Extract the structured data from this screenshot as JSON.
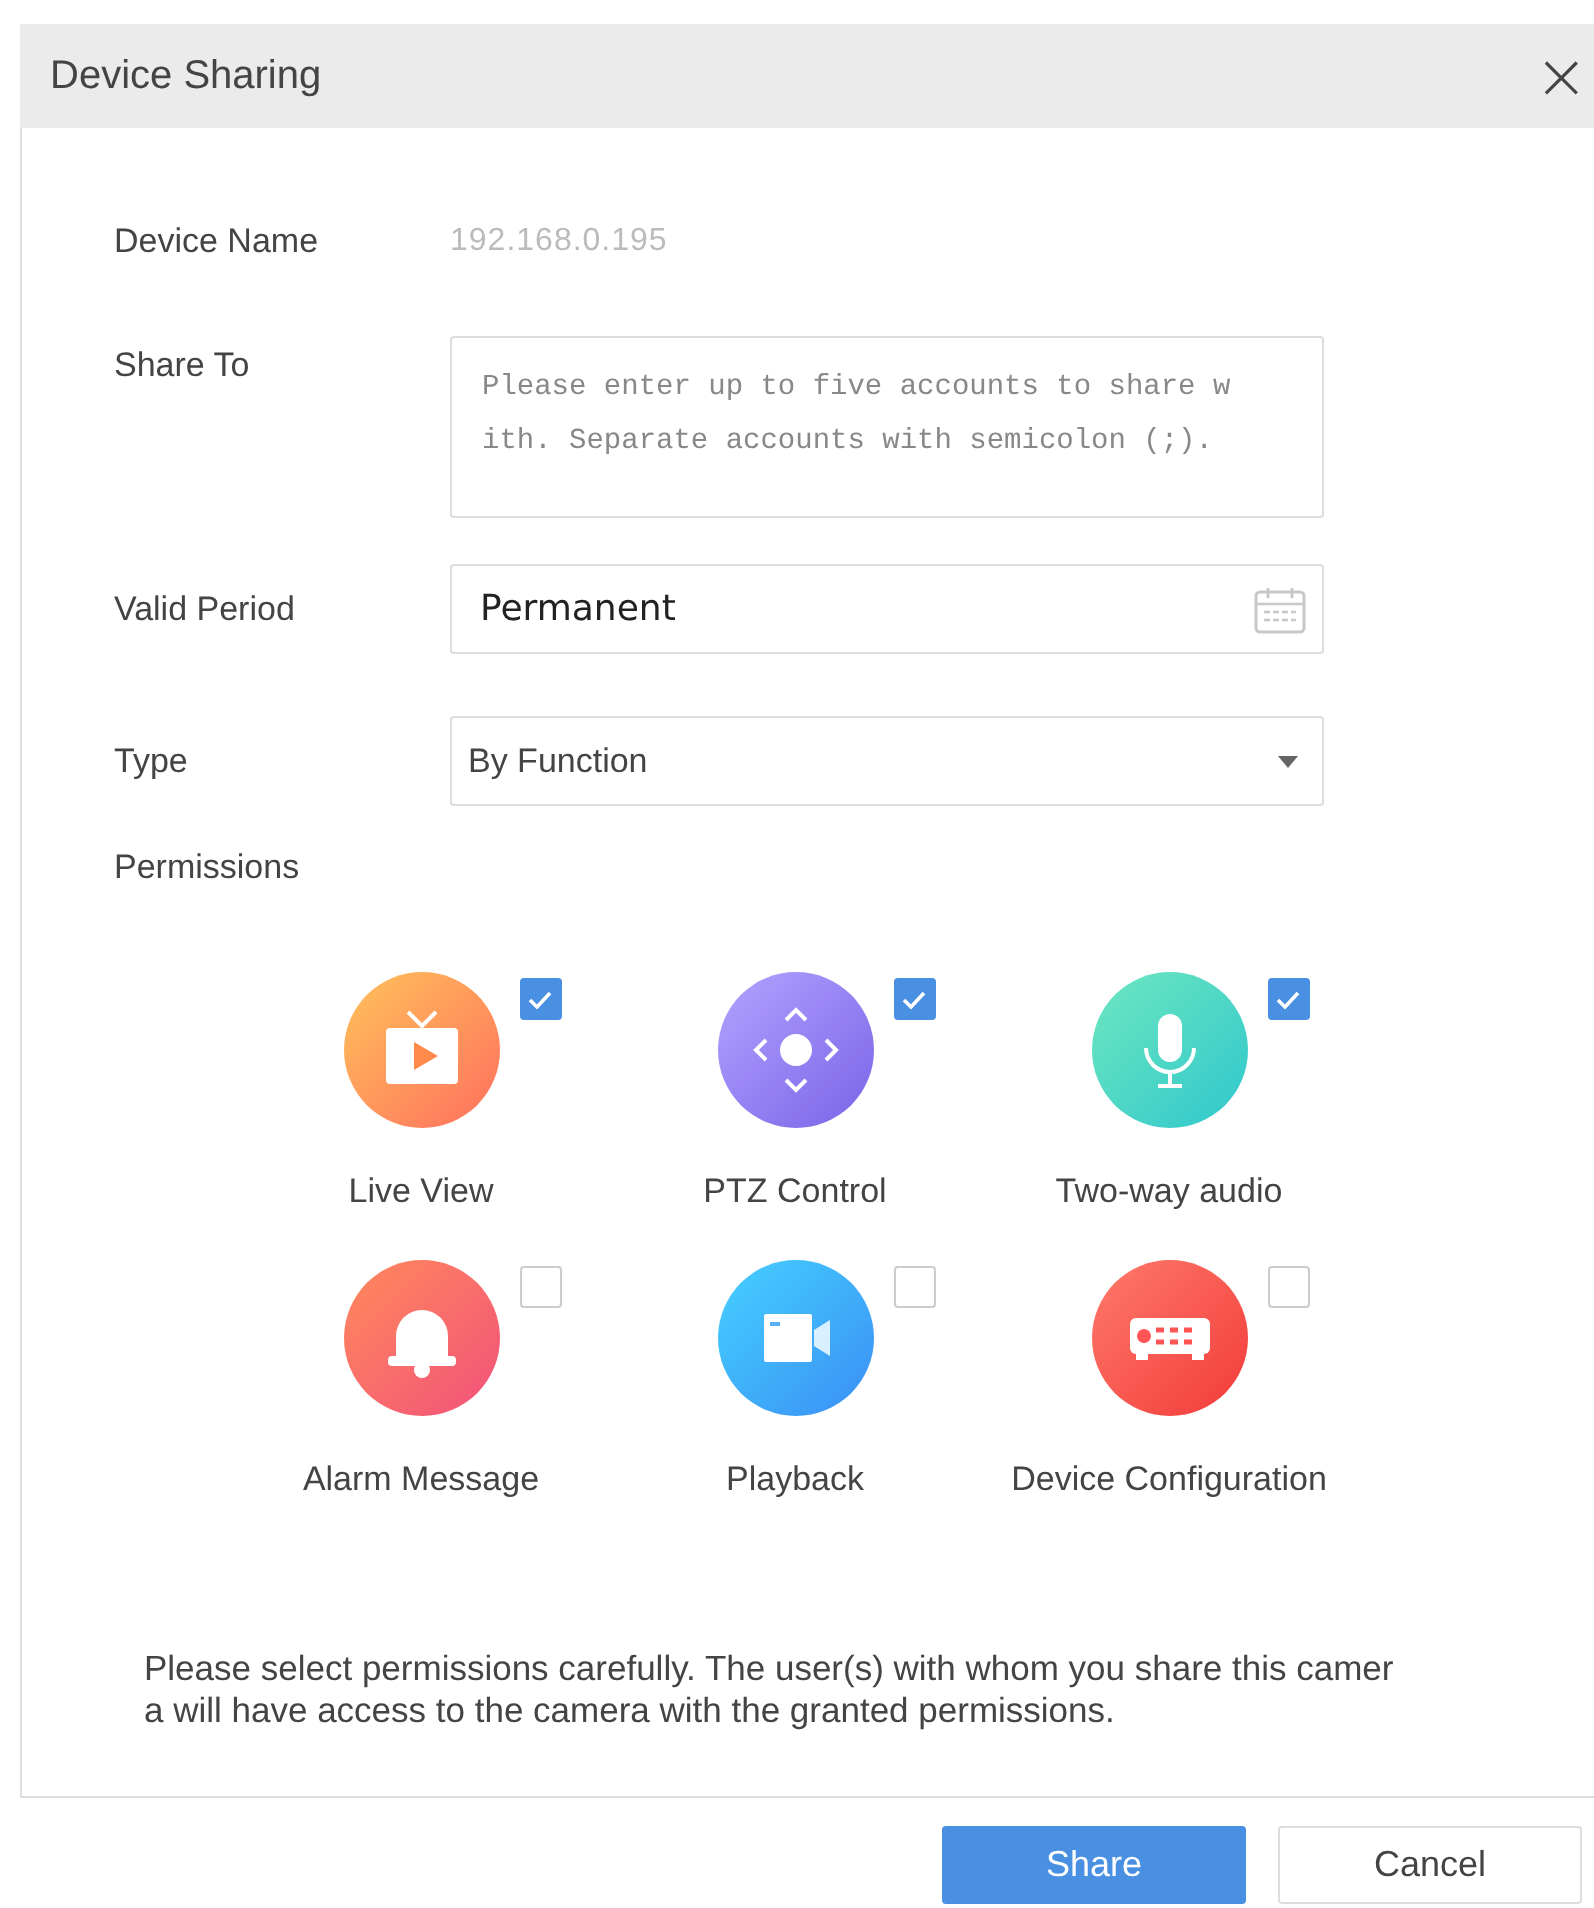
{
  "dialog": {
    "title": "Device Sharing",
    "close": "×"
  },
  "form": {
    "device_name_label": "Device Name",
    "device_name": "192.168.0.195",
    "share_to_label": "Share To",
    "share_to": {
      "placeholder": "Please enter up to five accounts to share with. Separate accounts with semicolon (;)."
    },
    "valid_period_label": "Valid Period",
    "valid_period": "Permanent",
    "type_label": "Type",
    "type": "By Function",
    "permissions_label": "Permissions"
  },
  "permissions": [
    {
      "label": "Live View",
      "kind": "tv",
      "checked": true
    },
    {
      "label": "PTZ Control",
      "kind": "ptz",
      "checked": true
    },
    {
      "label": "Two-way audio",
      "kind": "mic",
      "checked": true
    },
    {
      "label": "Alarm Message",
      "kind": "bell",
      "checked": false
    },
    {
      "label": "Playback",
      "kind": "camera",
      "checked": false
    },
    {
      "label": "Device Configuration",
      "kind": "device",
      "checked": false
    }
  ],
  "note": "Please select permissions carefully. The user(s) with whom you share this camera will have access to the camera with the granted permissions.",
  "buttons": [
    {
      "label": "Share",
      "kind": "primary"
    },
    {
      "label": "Cancel",
      "kind": "secondary"
    }
  ]
}
